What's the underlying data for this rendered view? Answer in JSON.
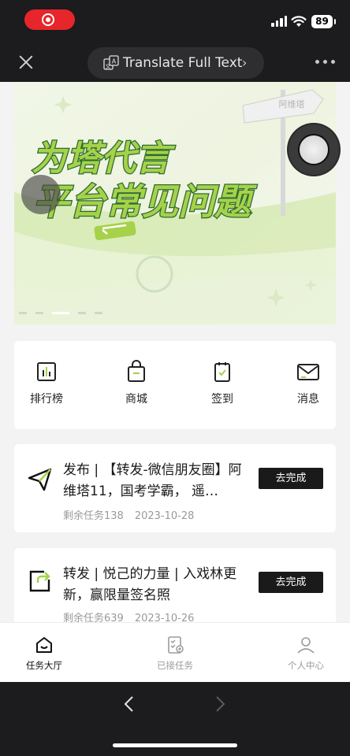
{
  "status_bar": {
    "time": "",
    "battery": "89",
    "recording": true
  },
  "top_bar": {
    "translate_label": "Translate Full Text",
    "translate_chevron": "›"
  },
  "banner": {
    "line1": "为塔代言",
    "line2": "平台常见问题",
    "sign_text": "阿维塔",
    "pagination": {
      "count": 5,
      "active": 2
    }
  },
  "quick_actions": [
    {
      "label": "排行榜",
      "icon": "ranking-icon"
    },
    {
      "label": "商城",
      "icon": "shop-bag-icon"
    },
    {
      "label": "签到",
      "icon": "checkin-clipboard-icon"
    },
    {
      "label": "消息",
      "icon": "message-envelope-icon"
    }
  ],
  "tasks": [
    {
      "icon": "send-plane-icon",
      "title": "发布 | 【转发-微信朋友圈】阿维塔11，国考学霸， 遥…",
      "remaining": "剩余任务138",
      "date": "2023-10-28",
      "action": "去完成"
    },
    {
      "icon": "forward-share-icon",
      "title": "转发 | 悦己的力量 | 入戏林更新，赢限量签名照",
      "remaining": "剩余任务639",
      "date": "2023-10-26",
      "action": "去完成"
    }
  ],
  "tab_bar": [
    {
      "label": "任务大厅",
      "icon": "home-smile-icon",
      "active": true
    },
    {
      "label": "已接任务",
      "icon": "accepted-tasks-icon",
      "active": false
    },
    {
      "label": "个人中心",
      "icon": "person-icon",
      "active": false
    }
  ],
  "colors": {
    "accent_green": "#a6d14a",
    "dark_bar": "#1c1b1d",
    "record_red": "#e6262a"
  }
}
